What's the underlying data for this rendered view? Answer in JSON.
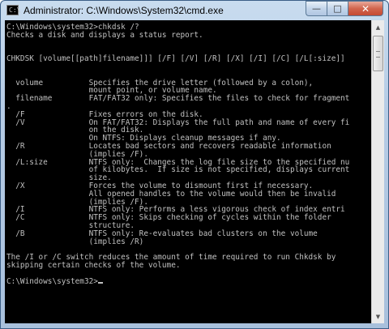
{
  "window": {
    "title": "Administrator: C:\\Windows\\System32\\cmd.exe",
    "icon_text": "C:\\",
    "minimize_icon": "minimize-icon",
    "maximize_icon": "maximize-icon",
    "close_icon": "close-icon",
    "minimize_glyph": "—",
    "maximize_glyph": "□",
    "close_glyph": "✕"
  },
  "console": {
    "foreground": "#c0c0c0",
    "background": "#000000",
    "text": "C:\\Windows\\system32>chkdsk /?\nChecks a disk and displays a status report.\n\n\nCHKDSK [volume[[path]filename]]] [/F] [/V] [/R] [/X] [/I] [/C] [/L[:size]]\n\n\n  volume          Specifies the drive letter (followed by a colon),\n                  mount point, or volume name.\n  filename        FAT/FAT32 only: Specifies the files to check for fragment\n.\n  /F              Fixes errors on the disk.\n  /V              On FAT/FAT32: Displays the full path and name of every fi\n                  on the disk.\n                  On NTFS: Displays cleanup messages if any.\n  /R              Locates bad sectors and recovers readable information\n                  (implies /F).\n  /L:size         NTFS only:  Changes the log file size to the specified nu\n                  of kilobytes.  If size is not specified, displays current\n                  size.\n  /X              Forces the volume to dismount first if necessary.\n                  All opened handles to the volume would then be invalid\n                  (implies /F).\n  /I              NTFS only: Performs a less vigorous check of index entri\n  /C              NTFS only: Skips checking of cycles within the folder\n                  structure.\n  /B              NTFS only: Re-evaluates bad clusters on the volume\n                  (implies /R)\n\nThe /I or /C switch reduces the amount of time required to run Chkdsk by\nskipping certain checks of the volume.\n\nC:\\Windows\\system32>"
  },
  "scrollbar": {
    "up_icon": "scroll-up-arrow-icon",
    "down_icon": "scroll-down-arrow-icon",
    "up_glyph": "▲",
    "down_glyph": "▼"
  }
}
